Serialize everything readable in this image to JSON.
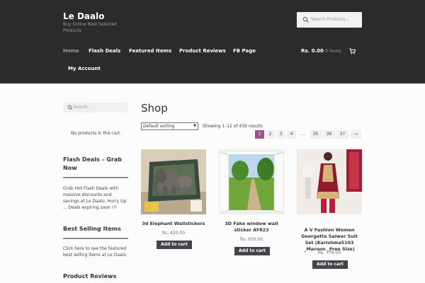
{
  "site": {
    "title": "Le Daalo",
    "tagline": "Buy Online Best Selected Products"
  },
  "search": {
    "placeholder": "Search Products…"
  },
  "nav": {
    "items": [
      {
        "label": "Home"
      },
      {
        "label": "Flash Deals"
      },
      {
        "label": "Featured Items"
      },
      {
        "label": "Product Reviews"
      },
      {
        "label": "FB Page"
      },
      {
        "label": "My Account"
      }
    ]
  },
  "cart": {
    "total": "Rs. 0.00",
    "count": "0 items",
    "empty_message": "No products in the cart."
  },
  "sidebar": {
    "search_placeholder": "Search …",
    "widgets": [
      {
        "title": "Flash Deals – Grab Now",
        "text": "Grab Hot Flash Deals with massive discounts and savings at Le Daalo. Hurry Up ... Deals expiring soon !!!"
      },
      {
        "title": "Best Selling Items",
        "text": "Click here to see the featured best selling items at Le Daalo"
      },
      {
        "title": "Product Reviews",
        "text": ""
      }
    ]
  },
  "shop": {
    "title": "Shop",
    "sort_selected": "Default sorting",
    "result_count": "Showing 1–12 of 439 results",
    "pagination": [
      "1",
      "2",
      "3",
      "4",
      "…",
      "35",
      "36",
      "37",
      "→"
    ]
  },
  "products": [
    {
      "name": "3d Elephant Wallstickers",
      "price": "Rs. 420.00",
      "button": "Add to cart"
    },
    {
      "name": "3D Fake window wall sticker AY823",
      "price": "Rs. 650.00",
      "button": "Add to cart"
    },
    {
      "name": "A V Fashion Women Georgette Salwar Suit Set (Karishma5103 _Maroon _Free Size)",
      "price": "Rs. 779.00",
      "button": "Add to cart"
    }
  ],
  "colors": {
    "header_bg": "#2b2b2d",
    "accent": "#96588a",
    "button_bg": "#43454b"
  }
}
